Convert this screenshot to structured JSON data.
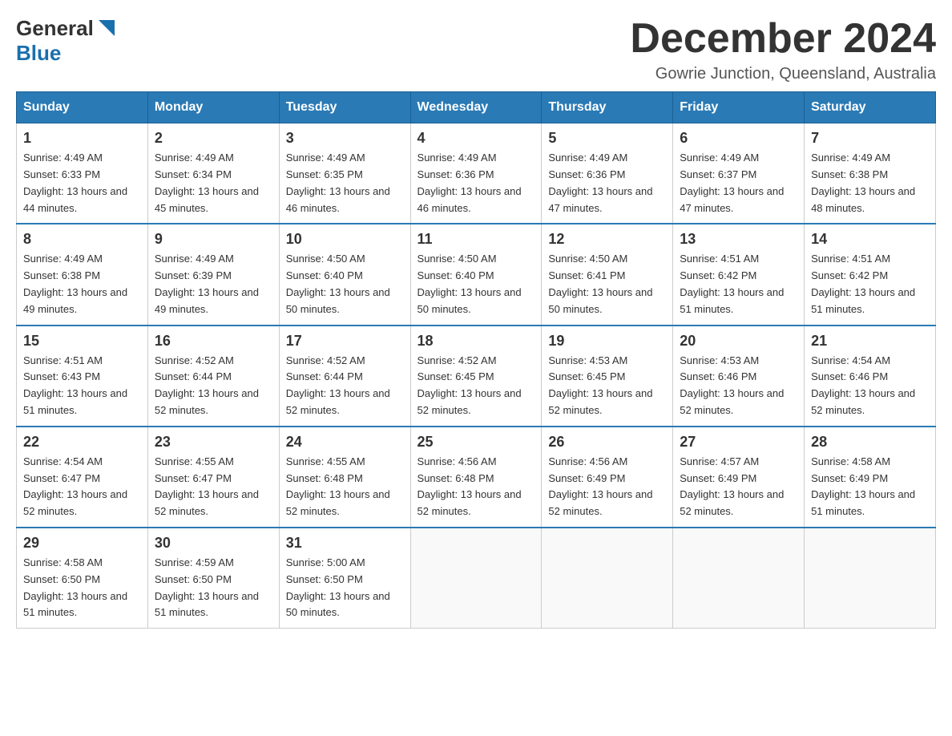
{
  "header": {
    "logo_line1": "General",
    "logo_line2": "Blue",
    "month_title": "December 2024",
    "subtitle": "Gowrie Junction, Queensland, Australia"
  },
  "weekdays": [
    "Sunday",
    "Monday",
    "Tuesday",
    "Wednesday",
    "Thursday",
    "Friday",
    "Saturday"
  ],
  "weeks": [
    [
      {
        "day": "1",
        "sunrise": "4:49 AM",
        "sunset": "6:33 PM",
        "daylight": "13 hours and 44 minutes."
      },
      {
        "day": "2",
        "sunrise": "4:49 AM",
        "sunset": "6:34 PM",
        "daylight": "13 hours and 45 minutes."
      },
      {
        "day": "3",
        "sunrise": "4:49 AM",
        "sunset": "6:35 PM",
        "daylight": "13 hours and 46 minutes."
      },
      {
        "day": "4",
        "sunrise": "4:49 AM",
        "sunset": "6:36 PM",
        "daylight": "13 hours and 46 minutes."
      },
      {
        "day": "5",
        "sunrise": "4:49 AM",
        "sunset": "6:36 PM",
        "daylight": "13 hours and 47 minutes."
      },
      {
        "day": "6",
        "sunrise": "4:49 AM",
        "sunset": "6:37 PM",
        "daylight": "13 hours and 47 minutes."
      },
      {
        "day": "7",
        "sunrise": "4:49 AM",
        "sunset": "6:38 PM",
        "daylight": "13 hours and 48 minutes."
      }
    ],
    [
      {
        "day": "8",
        "sunrise": "4:49 AM",
        "sunset": "6:38 PM",
        "daylight": "13 hours and 49 minutes."
      },
      {
        "day": "9",
        "sunrise": "4:49 AM",
        "sunset": "6:39 PM",
        "daylight": "13 hours and 49 minutes."
      },
      {
        "day": "10",
        "sunrise": "4:50 AM",
        "sunset": "6:40 PM",
        "daylight": "13 hours and 50 minutes."
      },
      {
        "day": "11",
        "sunrise": "4:50 AM",
        "sunset": "6:40 PM",
        "daylight": "13 hours and 50 minutes."
      },
      {
        "day": "12",
        "sunrise": "4:50 AM",
        "sunset": "6:41 PM",
        "daylight": "13 hours and 50 minutes."
      },
      {
        "day": "13",
        "sunrise": "4:51 AM",
        "sunset": "6:42 PM",
        "daylight": "13 hours and 51 minutes."
      },
      {
        "day": "14",
        "sunrise": "4:51 AM",
        "sunset": "6:42 PM",
        "daylight": "13 hours and 51 minutes."
      }
    ],
    [
      {
        "day": "15",
        "sunrise": "4:51 AM",
        "sunset": "6:43 PM",
        "daylight": "13 hours and 51 minutes."
      },
      {
        "day": "16",
        "sunrise": "4:52 AM",
        "sunset": "6:44 PM",
        "daylight": "13 hours and 52 minutes."
      },
      {
        "day": "17",
        "sunrise": "4:52 AM",
        "sunset": "6:44 PM",
        "daylight": "13 hours and 52 minutes."
      },
      {
        "day": "18",
        "sunrise": "4:52 AM",
        "sunset": "6:45 PM",
        "daylight": "13 hours and 52 minutes."
      },
      {
        "day": "19",
        "sunrise": "4:53 AM",
        "sunset": "6:45 PM",
        "daylight": "13 hours and 52 minutes."
      },
      {
        "day": "20",
        "sunrise": "4:53 AM",
        "sunset": "6:46 PM",
        "daylight": "13 hours and 52 minutes."
      },
      {
        "day": "21",
        "sunrise": "4:54 AM",
        "sunset": "6:46 PM",
        "daylight": "13 hours and 52 minutes."
      }
    ],
    [
      {
        "day": "22",
        "sunrise": "4:54 AM",
        "sunset": "6:47 PM",
        "daylight": "13 hours and 52 minutes."
      },
      {
        "day": "23",
        "sunrise": "4:55 AM",
        "sunset": "6:47 PM",
        "daylight": "13 hours and 52 minutes."
      },
      {
        "day": "24",
        "sunrise": "4:55 AM",
        "sunset": "6:48 PM",
        "daylight": "13 hours and 52 minutes."
      },
      {
        "day": "25",
        "sunrise": "4:56 AM",
        "sunset": "6:48 PM",
        "daylight": "13 hours and 52 minutes."
      },
      {
        "day": "26",
        "sunrise": "4:56 AM",
        "sunset": "6:49 PM",
        "daylight": "13 hours and 52 minutes."
      },
      {
        "day": "27",
        "sunrise": "4:57 AM",
        "sunset": "6:49 PM",
        "daylight": "13 hours and 52 minutes."
      },
      {
        "day": "28",
        "sunrise": "4:58 AM",
        "sunset": "6:49 PM",
        "daylight": "13 hours and 51 minutes."
      }
    ],
    [
      {
        "day": "29",
        "sunrise": "4:58 AM",
        "sunset": "6:50 PM",
        "daylight": "13 hours and 51 minutes."
      },
      {
        "day": "30",
        "sunrise": "4:59 AM",
        "sunset": "6:50 PM",
        "daylight": "13 hours and 51 minutes."
      },
      {
        "day": "31",
        "sunrise": "5:00 AM",
        "sunset": "6:50 PM",
        "daylight": "13 hours and 50 minutes."
      },
      null,
      null,
      null,
      null
    ]
  ],
  "labels": {
    "sunrise_prefix": "Sunrise: ",
    "sunset_prefix": "Sunset: ",
    "daylight_prefix": "Daylight: "
  }
}
